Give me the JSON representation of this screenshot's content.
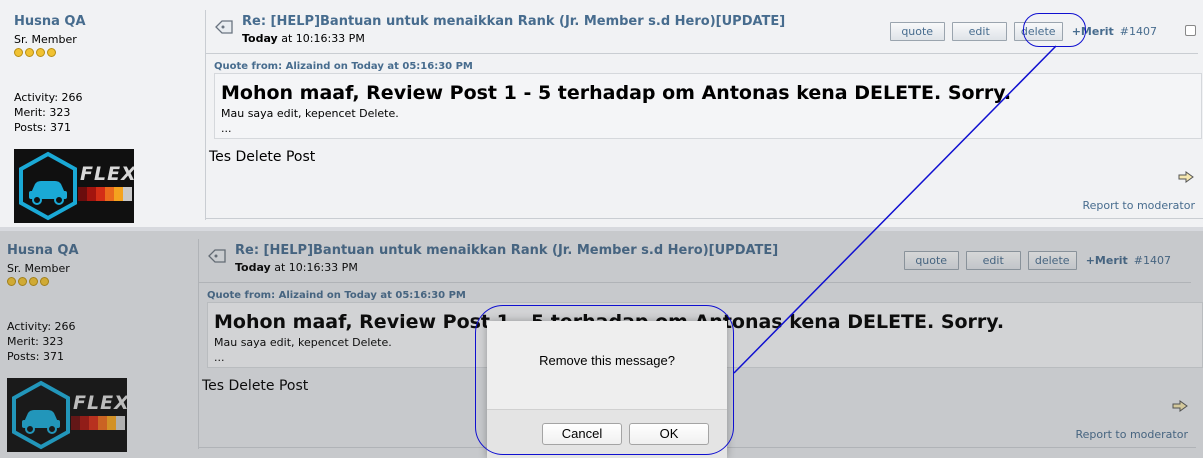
{
  "poster": {
    "name": "Husna QA",
    "rank": "Sr. Member",
    "activity": "Activity: 266",
    "merit": "Merit: 323",
    "posts": "Posts: 371",
    "avatar_text": "FLEX"
  },
  "post": {
    "subject": "Re: [HELP]Bantuan untuk menaikkan Rank (Jr. Member s.d Hero)[UPDATE]",
    "time_bold": "Today",
    "time_rest": " at 10:16:33 PM",
    "buttons": {
      "quote": "quote",
      "edit": "edit",
      "delete": "delete"
    },
    "merit_link": "+Merit",
    "msg_number": "#1407",
    "quote_header": "Quote from: Alizaind on Today at 05:16:30 PM",
    "quote_title": "Mohon maaf, Review Post 1 - 5 terhadap om Antonas kena DELETE. Sorry.",
    "quote_line": "Mau saya edit, kepencet Delete.",
    "quote_ellipsis": "...",
    "body": "Tes Delete Post",
    "report": "Report to moderator"
  },
  "dialog": {
    "message": "Remove this message?",
    "cancel": "Cancel",
    "ok": "OK"
  },
  "colors": {
    "link": "#476c8e",
    "annotation": "#1010d0"
  }
}
